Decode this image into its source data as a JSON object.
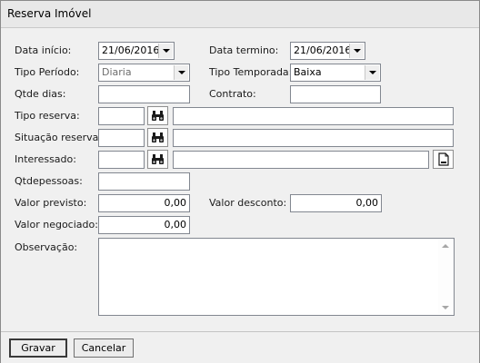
{
  "window": {
    "title": "Reserva Imóvel"
  },
  "form": {
    "data_inicio": {
      "label": "Data início:",
      "value": "21/06/2016"
    },
    "data_termino": {
      "label": "Data termino:",
      "value": "21/06/2016"
    },
    "tipo_periodo": {
      "label": "Tipo Período:",
      "value": "Diaria"
    },
    "tipo_temporada": {
      "label": "Tipo Temporada:",
      "value": "Baixa"
    },
    "qtde_dias": {
      "label": "Qtde dias:",
      "value": ""
    },
    "contrato": {
      "label": "Contrato:",
      "value": ""
    },
    "tipo_reserva": {
      "label": "Tipo reserva:",
      "code": "",
      "description": ""
    },
    "situacao_reserva": {
      "label": "Situação reserva:",
      "code": "",
      "description": ""
    },
    "interessado": {
      "label": "Interessado:",
      "code": "",
      "description": ""
    },
    "qtdepessoas": {
      "label": "Qtdepessoas:",
      "value": ""
    },
    "valor_previsto": {
      "label": "Valor previsto:",
      "value": "0,00"
    },
    "valor_desconto": {
      "label": "Valor desconto:",
      "value": "0,00"
    },
    "valor_negociado": {
      "label": "Valor negociado:",
      "value": "0,00"
    },
    "observacao": {
      "label": "Observação:",
      "value": ""
    }
  },
  "icons": {
    "lookup": "binoculars-icon",
    "new_record": "new-document-icon"
  },
  "buttons": {
    "save": "Gravar",
    "cancel": "Cancelar"
  }
}
